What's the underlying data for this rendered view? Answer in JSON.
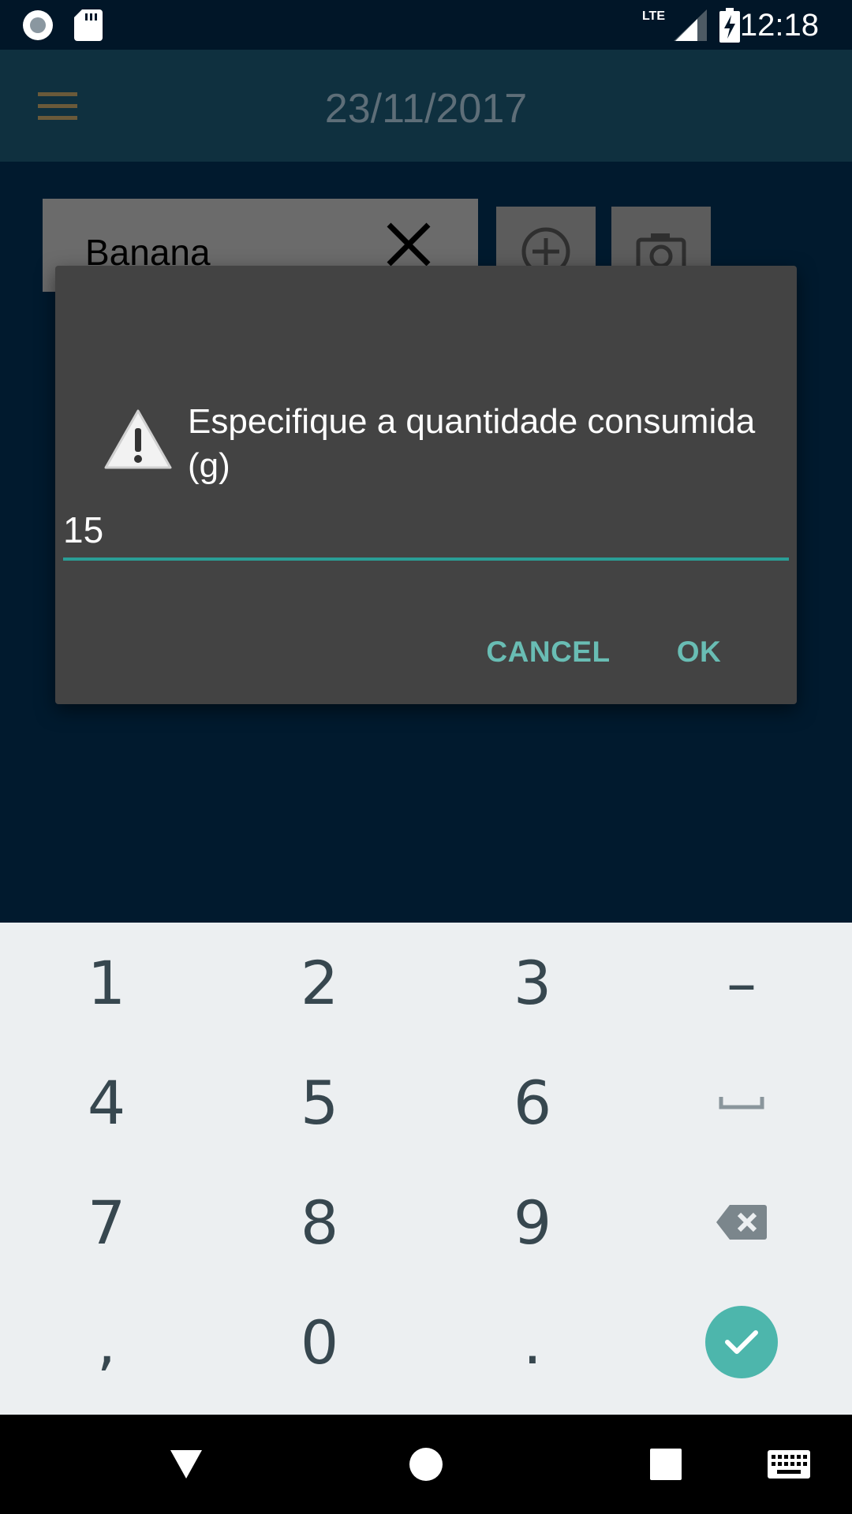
{
  "status_bar": {
    "time": "12:18",
    "network_label": "LTE",
    "icons": [
      "record-icon",
      "sd-card-icon",
      "signal-icon",
      "battery-charging-icon"
    ]
  },
  "app_bar": {
    "title": "23/11/2017",
    "menu_icon": "hamburger-menu-icon"
  },
  "content": {
    "food_field_value": "Banana",
    "clear_icon": "close-icon",
    "add_icon": "add-circle-icon",
    "camera_icon": "camera-icon"
  },
  "dialog": {
    "icon": "warning-icon",
    "title": "Especifique a quantidade consumida (g)",
    "input_value": "15",
    "cancel_label": "CANCEL",
    "ok_label": "OK",
    "accent_color": "#2a9e96"
  },
  "keyboard": {
    "rows": [
      [
        "1",
        "2",
        "3",
        "–"
      ],
      [
        "4",
        "5",
        "6",
        "space-icon"
      ],
      [
        "7",
        "8",
        "9",
        "backspace-icon"
      ],
      [
        ",",
        "0",
        ".",
        "enter-check-icon"
      ]
    ],
    "k1": "1",
    "k2": "2",
    "k3": "3",
    "kminus": "–",
    "k4": "4",
    "k5": "5",
    "k6": "6",
    "k7": "7",
    "k8": "8",
    "k9": "9",
    "kcomma": ",",
    "k0": "0",
    "kdot": ".",
    "enter_color": "#4db6ac"
  },
  "nav_bar": {
    "icons": [
      "back-icon",
      "home-icon",
      "recents-icon",
      "keyboard-switch-icon"
    ]
  }
}
